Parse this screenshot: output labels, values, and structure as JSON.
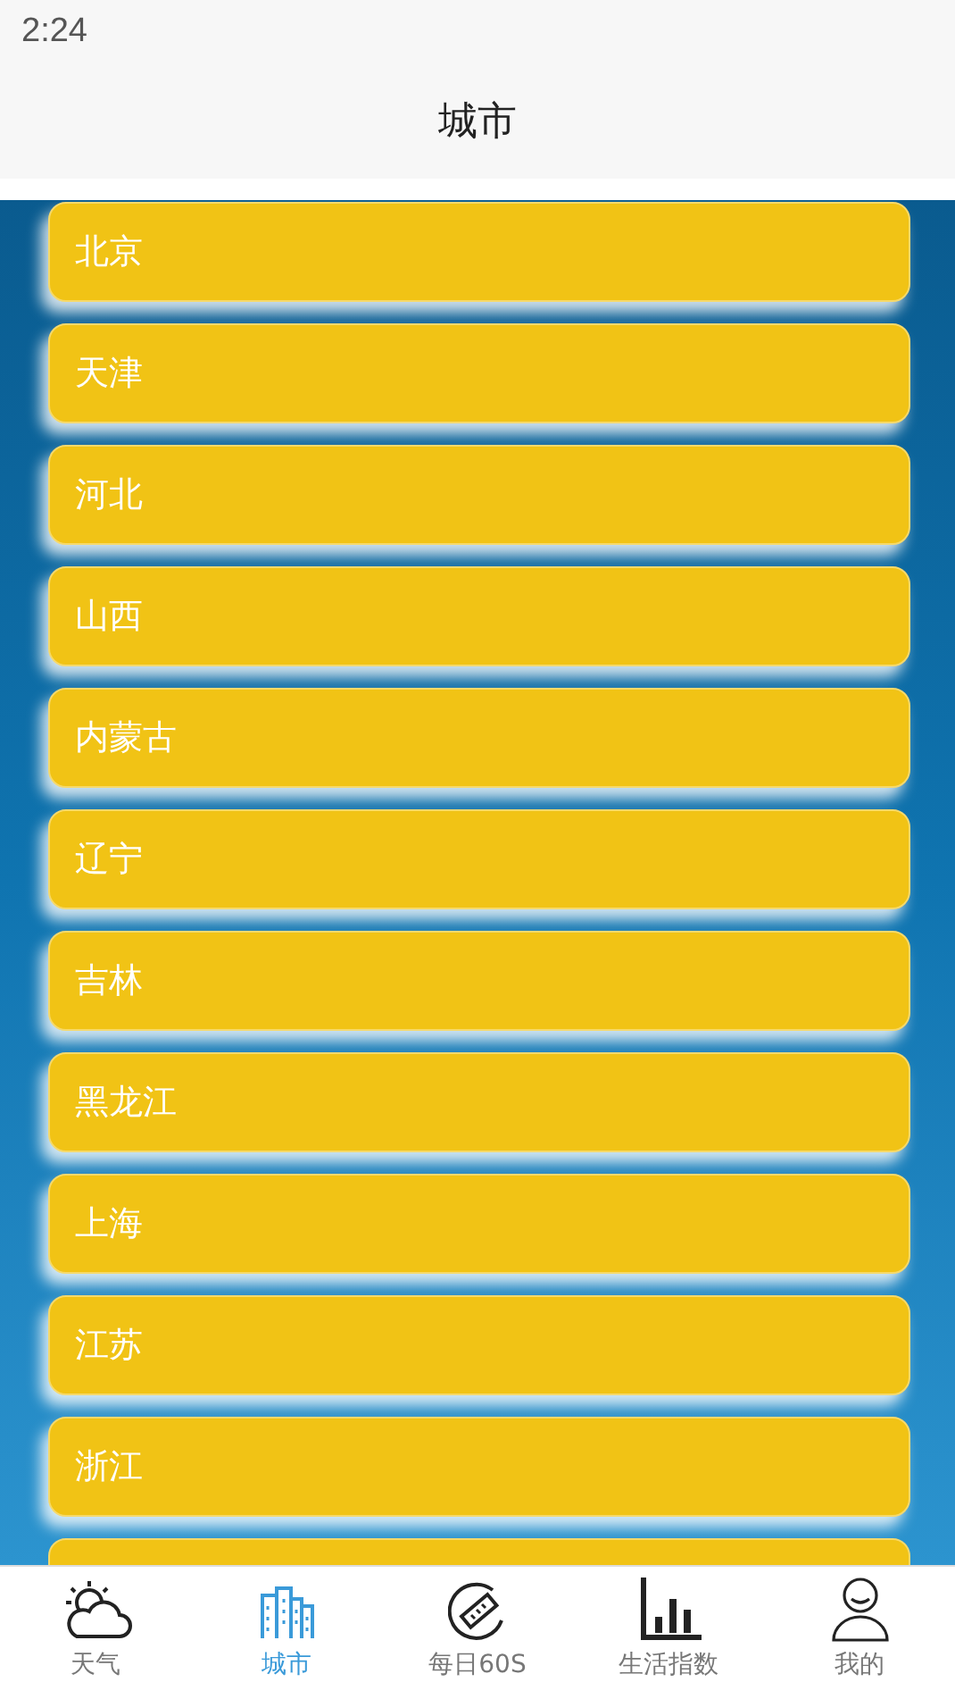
{
  "status_bar": {
    "time": "2:24"
  },
  "header": {
    "title": "城市"
  },
  "cities": [
    {
      "name": "北京"
    },
    {
      "name": "天津"
    },
    {
      "name": "河北"
    },
    {
      "name": "山西"
    },
    {
      "name": "内蒙古"
    },
    {
      "name": "辽宁"
    },
    {
      "name": "吉林"
    },
    {
      "name": "黑龙江"
    },
    {
      "name": "上海"
    },
    {
      "name": "江苏"
    },
    {
      "name": "浙江"
    }
  ],
  "tabs": [
    {
      "kind": "weather",
      "label": "天气",
      "selected": false
    },
    {
      "kind": "city",
      "label": "城市",
      "selected": true
    },
    {
      "kind": "daily",
      "label": "每日60S",
      "selected": false
    },
    {
      "kind": "life",
      "label": "生活指数",
      "selected": false
    },
    {
      "kind": "me",
      "label": "我的",
      "selected": false
    }
  ]
}
